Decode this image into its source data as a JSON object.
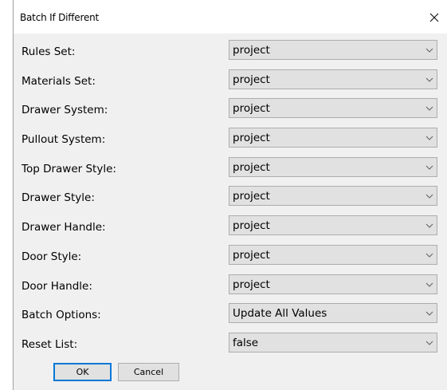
{
  "dialog": {
    "title": "Batch If Different",
    "close_glyph": "close-icon"
  },
  "rows": [
    {
      "label": "Rules Set:",
      "value": "project"
    },
    {
      "label": "Materials Set:",
      "value": "project"
    },
    {
      "label": "Drawer System:",
      "value": "project"
    },
    {
      "label": "Pullout System:",
      "value": "project"
    },
    {
      "label": "Top Drawer Style:",
      "value": "project"
    },
    {
      "label": "Drawer Style:",
      "value": "project"
    },
    {
      "label": "Drawer Handle:",
      "value": "project"
    },
    {
      "label": "Door Style:",
      "value": "project"
    },
    {
      "label": "Door Handle:",
      "value": "project"
    },
    {
      "label": "Batch Options:",
      "value": "Update All Values"
    },
    {
      "label": "Reset List:",
      "value": "false"
    }
  ],
  "buttons": {
    "ok": "OK",
    "cancel": "Cancel"
  },
  "colors": {
    "content_bg": "#f0f0f0",
    "select_bg": "#e1e1e1",
    "select_border": "#adadad",
    "focus_accent": "#0078d7"
  },
  "icons": {
    "dropdown": "chevron-down-icon",
    "close": "close-icon"
  }
}
